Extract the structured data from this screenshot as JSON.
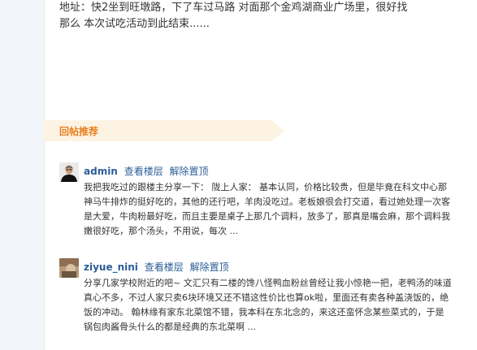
{
  "post": {
    "lines": [
      "地址：快2坐到旺墩路，下了车过马路 对面那个金鸡湖商业广场里，很好找",
      "那么 本次试吃活动到此结束......"
    ]
  },
  "replies_section": {
    "title": "回帖推荐",
    "accent_color": "#e8801e",
    "banner_color": "#fdf3e3"
  },
  "replies": [
    {
      "username": "admin",
      "view_floor": "查看楼层",
      "unpin": "解除置顶",
      "lines": [
        "我把我吃过的跟楼主分享一下： 陇上人家： 基本认同，价格比较贵，但是毕竟在科文中心那",
        "神马牛排炸的挺好吃的，其他的还行吧，羊肉没吃过。老板娘很会打交道，看过她处理一次客",
        "是大爱，牛肉粉最好吃，而且主要是桌子上那几个调料，放多了，那真是嘴会麻，那个调料我",
        "嫩很好吃，那个汤头，不用说，每次 ..."
      ]
    },
    {
      "username": "ziyue_nini",
      "view_floor": "查看楼层",
      "unpin": "解除置顶",
      "lines": [
        "分享几家学校附近的吧~ 文汇只有二楼的馋八怪鸭血粉丝曾经让我小惊艳一把，老鸭汤的味道",
        "真心不多，不过人家只卖6块环境又还不错这性价比也算ok啦，里面还有卖各种盖浇饭的，绝",
        "饭的冲动。 翰林缘有家东北菜馆不错，我本科在东北念的，来这还蛮怀念某些菜式的，于是",
        "锅包肉酱骨头什么的都是经典的东北菜啊 ..."
      ]
    }
  ],
  "link_color": "#2b5d97"
}
